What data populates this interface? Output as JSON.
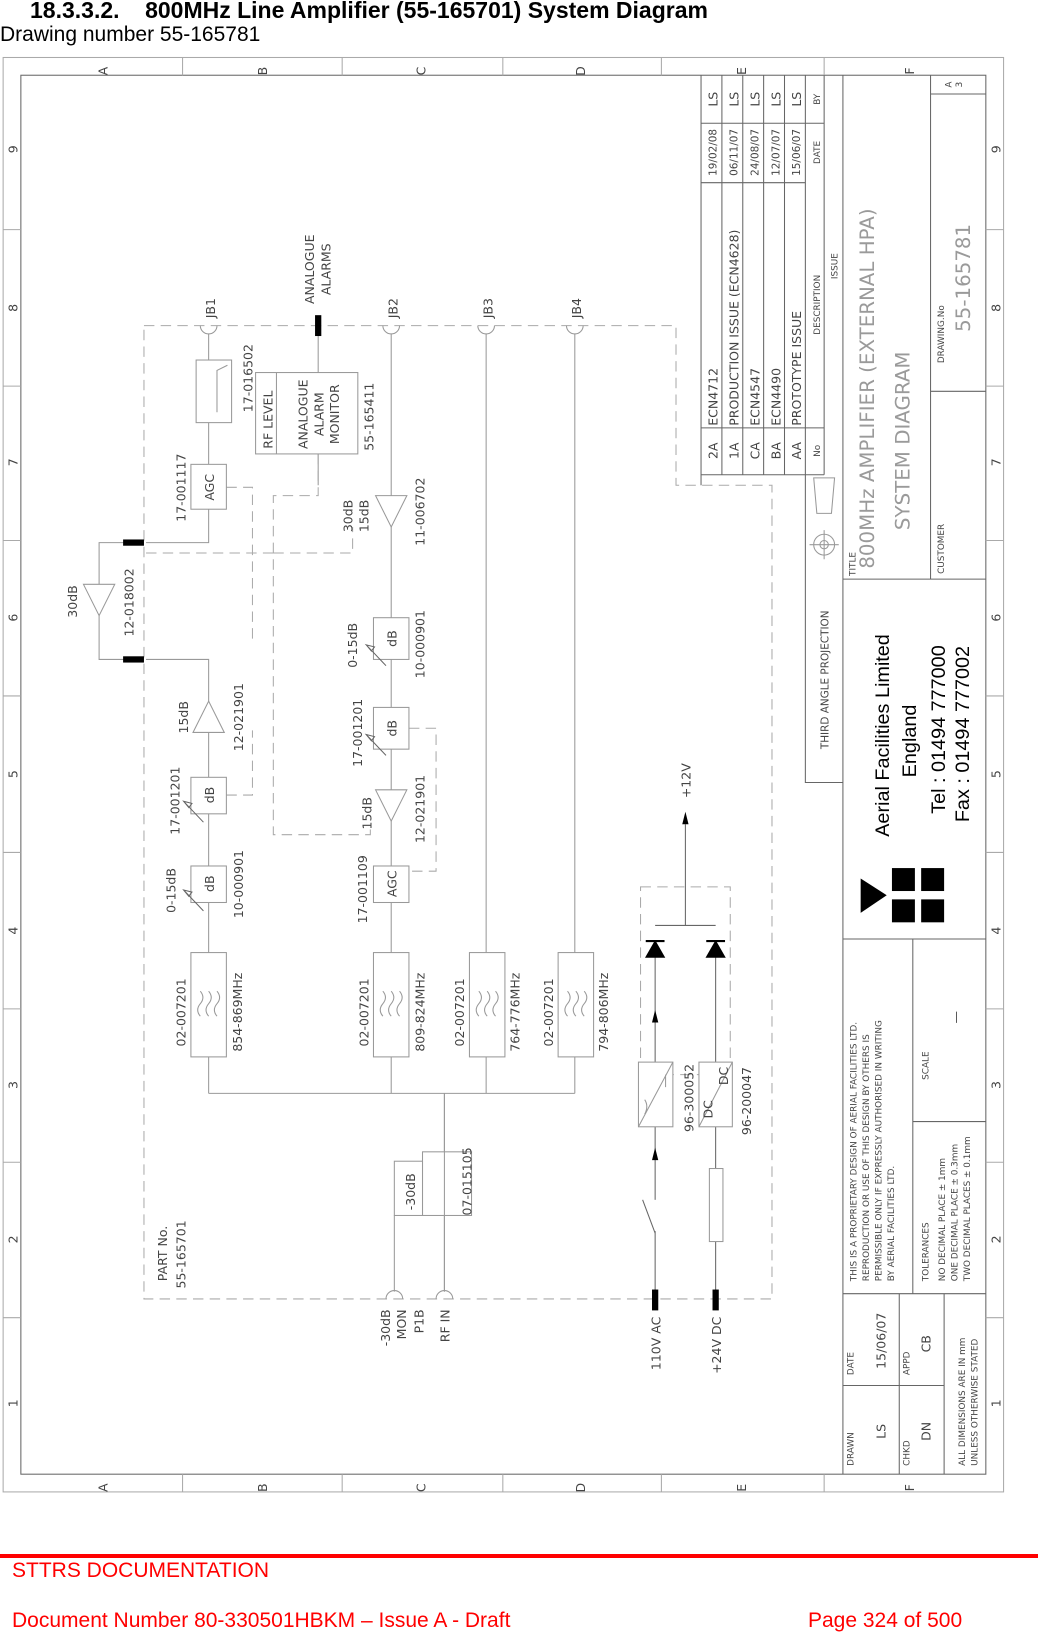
{
  "page": {
    "section_title": "18.3.3.2.    800MHz Line Amplifier (55-165701) System Diagram",
    "subtitle": "Drawing number 55-165781"
  },
  "footer": {
    "org": "STTRS DOCUMENTATION",
    "doc_number": "Document Number 80-330501HBKM – Issue A - Draft",
    "page": "Page 324 of 500",
    "color": "#ff0000"
  },
  "frame": {
    "columns": [
      "A",
      "B",
      "C",
      "D",
      "E",
      "F"
    ],
    "rows": [
      "9",
      "8",
      "7",
      "6",
      "5",
      "4",
      "3",
      "2",
      "1"
    ]
  },
  "schematic": {
    "junctions": [
      "JB1",
      "JB2",
      "JB3",
      "JB4"
    ],
    "alarm_connector": [
      "ANALOGUE",
      "ALARMS"
    ],
    "coupler_top": "17-016502",
    "alarm_monitor": {
      "rf_level": "RF LEVEL",
      "lines": [
        "ANALOGUE",
        "ALARM",
        "MONITOR"
      ],
      "part": "55-165411"
    },
    "agc1": {
      "label": "AGC",
      "part": "17-001117"
    },
    "amp30": {
      "gain": "30dB",
      "part": "12-018002"
    },
    "amp15a": {
      "gain": "15dB",
      "part": "12-021901"
    },
    "att_var1": {
      "label": "dB",
      "part": "17-001201"
    },
    "att_fix1": {
      "label": "dB",
      "range": "0-15dB",
      "part": "10-000901"
    },
    "filter1": {
      "part": "02-007201",
      "band": "854-869MHz"
    },
    "amp_jb2": {
      "gain1": "30dB",
      "gain2": "15dB",
      "part": "11-006702"
    },
    "att_fix2": {
      "label": "dB",
      "range": "0-15dB",
      "part": "10-000901"
    },
    "att_var2": {
      "label": "dB",
      "part": "17-001201"
    },
    "amp15b": {
      "gain": "15dB",
      "part": "12-021901"
    },
    "agc2": {
      "label": "AGC",
      "part": "17-001109"
    },
    "filter2": {
      "part": "02-007201",
      "band": "809-824MHz"
    },
    "filter3": {
      "part": "02-007201",
      "band": "764-776MHz"
    },
    "filter4": {
      "part": "02-007201",
      "band": "794-806MHz"
    },
    "coupler_in": {
      "label": "-30dB",
      "part": "07-015105"
    },
    "part_no": [
      "PART No.",
      "55-165701"
    ],
    "ports": {
      "mon": [
        "-30dB",
        "MON",
        "P1B"
      ],
      "rf_in": "RF IN",
      "ac": "110V AC",
      "dc": "+24V DC"
    },
    "psu_ac": {
      "part": "96-300052"
    },
    "psu_dc": {
      "in": "DC",
      "out": "DC",
      "part": "96-200047"
    },
    "rail": "+12V"
  },
  "revisions": {
    "headers": {
      "no": "No",
      "description": "DESCRIPTION",
      "date": "DATE",
      "by": "BY",
      "issue": "ISSUE"
    },
    "rows": [
      {
        "no": "2A",
        "description": "ECN4712",
        "date": "19/02/08",
        "by": "LS"
      },
      {
        "no": "1A",
        "description": "PRODUCTION ISSUE (ECN4628)",
        "date": "06/11/07",
        "by": "LS"
      },
      {
        "no": "CA",
        "description": "ECN4547",
        "date": "24/08/07",
        "by": "LS"
      },
      {
        "no": "BA",
        "description": "ECN4490",
        "date": "12/07/07",
        "by": "LS"
      },
      {
        "no": "AA",
        "description": "PROTOTYPE ISSUE",
        "date": "15/06/07",
        "by": "LS"
      }
    ]
  },
  "title_block": {
    "title_label": "TITLE",
    "title_line1": "800MHz AMPLIFIER (EXTERNAL HPA)",
    "title_line2": "SYSTEM DIAGRAM",
    "drawing_no_label": "DRAWING.No",
    "drawing_no": "55-165781",
    "sheet_size": [
      "A",
      "3"
    ],
    "customer_label": "CUSTOMER",
    "projection": "THIRD ANGLE PROJECTION",
    "company": {
      "name": "Aerial Facilities Limited",
      "country": "England",
      "tel": "Tel : 01494 777000",
      "fax": "Fax : 01494 777002"
    },
    "proprietary": [
      "THIS IS A PROPRIETARY DESIGN OF AERIAL FACILITIES LTD.",
      "REPRODUCTION OR USE OF THIS DESIGN BY OTHERS IS",
      "PERMISSIBLE ONLY IF EXPRESSLY AUTHORISED IN WRITING",
      "BY AERIAL FACILITIES LTD."
    ],
    "tolerances_label": "TOLERANCES",
    "tolerances": [
      "NO DECIMAL PLACE ± 1mm",
      "ONE DECIMAL PLACE ± 0.3mm",
      "TWO DECIMAL PLACES ± 0.1mm"
    ],
    "scale_label": "SCALE",
    "scale": "—",
    "drawn_label": "DRAWN",
    "drawn": "LS",
    "date_label": "DATE",
    "date": "15/06/07",
    "chkd_label": "CHKD",
    "chkd": "DN",
    "appd_label": "APPD",
    "appd": "CB",
    "dimensions": [
      "ALL DIMENSIONS ARE IN mm",
      "UNLESS OTHERWISE STATED"
    ]
  }
}
